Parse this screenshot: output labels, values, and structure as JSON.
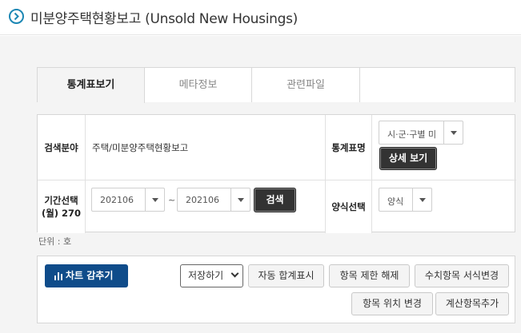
{
  "header": {
    "title": "미분양주택현황보고 (Unsold New Housings)"
  },
  "tabs": [
    {
      "label": "통계표보기",
      "active": true
    },
    {
      "label": "메타정보",
      "active": false
    },
    {
      "label": "관련파일",
      "active": false
    }
  ],
  "search_panel": {
    "search_field_label": "검색분야",
    "search_field_value": "주택/미분양주택현황보고",
    "stat_name_label": "통계표명",
    "stat_select_value": "시·군·구별 미",
    "detail_button": "상세 보기",
    "period_label": "기간선택\n(월) 270",
    "period_start": "202106",
    "period_separator": "~",
    "period_end": "202106",
    "search_button": "검색",
    "format_label": "양식선택",
    "format_select_value": "양식"
  },
  "unit_text": "단위 : 호",
  "toolbar": {
    "chart_toggle": "차트 감추기",
    "save_select": "저장하기",
    "auto_sum": "자동 합계표시",
    "item_limit_release": "항목 제한 해제",
    "numeric_format_change": "수치항목 서식변경",
    "item_position_change": "항목 위치 변경",
    "calc_item_add": "계산항목추가"
  },
  "colors": {
    "accent_blue": "#0f4c8a",
    "header_icon": "#1c87b4",
    "dark_button": "#333333"
  }
}
